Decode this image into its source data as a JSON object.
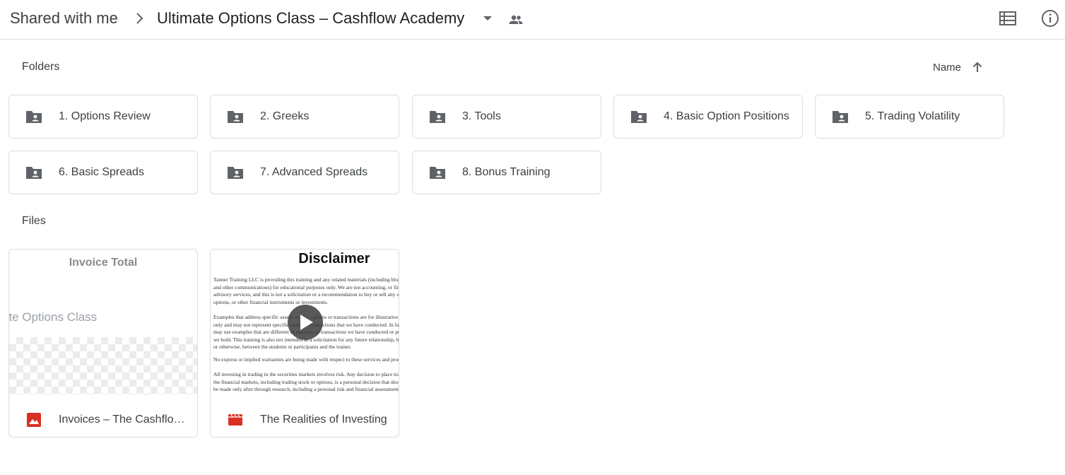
{
  "header": {
    "root_crumb": "Shared with me",
    "current_folder": "Ultimate Options Class – Cashflow Academy"
  },
  "sections": {
    "folders_label": "Folders",
    "files_label": "Files",
    "sort_label": "Name"
  },
  "folders": [
    {
      "name": "1. Options Review"
    },
    {
      "name": "2. Greeks"
    },
    {
      "name": "3. Tools"
    },
    {
      "name": "4. Basic Option Positions"
    },
    {
      "name": "5. Trading Volatility"
    },
    {
      "name": "6. Basic Spreads"
    },
    {
      "name": "7. Advanced Spreads"
    },
    {
      "name": "8. Bonus Training"
    }
  ],
  "files": [
    {
      "name": "Invoices – The Cashflow Academy",
      "type_icon": "image-icon",
      "thumb_title": "Invoice Total",
      "thumb_subtitle": "ate Options Class"
    },
    {
      "name": "The Realities of Investing",
      "type_icon": "video-icon",
      "thumb_title": "Disclaimer",
      "thumb_paragraphs": [
        "Tanner Training LLC is providing this training and any related materials (including blog posts and other communications) for educational purposes only. We are not accounting, or financial advisory services, and this is not a solicitation or a recommendation to buy or sell any stocks, options, or other financial instruments or investments.",
        "Examples that address specific assets, stocks, options or transactions are for illustrative purposes only and may not represent specific trades or transactions that we have conducted. In fact, we may use examples that are different or opposite of transactions we have conducted or positions we hold. This training is also not intended as a solicitation for any future relationship, business or otherwise, between the students or participants and the trainer.",
        "No express or implied warranties are being made with respect to these services and products.",
        "All investing in trading in the securities markets involves risk. Any decision to place trades in the financial markets, including trading stock or options, is a personal decision that should only be made only after through research, including a personal risk and financial assessment."
      ]
    }
  ],
  "colors": {
    "icon_grey": "#5f6368",
    "border": "#dadce0",
    "image_red": "#d93025",
    "video_red": "#d93025"
  }
}
